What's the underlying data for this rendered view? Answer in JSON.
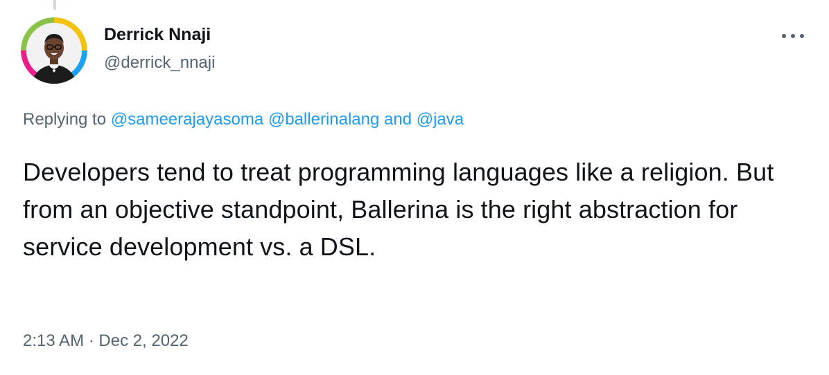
{
  "author": {
    "name": "Derrick Nnaji",
    "handle": "@derrick_nnaji"
  },
  "reply": {
    "prefix": "Replying to",
    "mention_1": "@sameerajayasoma",
    "mention_2": "@ballerinalang",
    "connector": "and",
    "mention_3": "@java"
  },
  "tweet": {
    "text": "Developers tend to treat programming languages like a religion. But from an objective standpoint, Ballerina is the right abstraction for service development vs. a DSL."
  },
  "meta": {
    "time": "2:13 AM",
    "separator": "·",
    "date": "Dec 2, 2022"
  },
  "icons": {
    "more": "more-horizontal-icon",
    "avatar": "profile-photo"
  },
  "colors": {
    "link": "#1d9bf0",
    "secondary_text": "#536471",
    "primary_text": "#0f1419",
    "avatar_ring_top": "#f4c20d",
    "avatar_ring_right": "#1da1f2",
    "avatar_ring_bottom": "#e91e8c",
    "avatar_ring_left": "#8bc34a"
  }
}
